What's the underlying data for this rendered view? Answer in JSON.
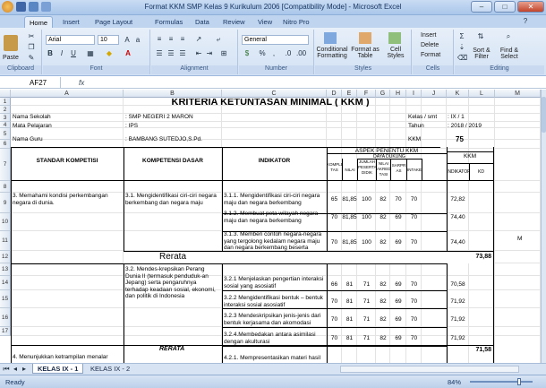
{
  "window": {
    "title": "Format KKM SMP Kelas 9 Kurikulum 2006  [Compatibility Mode]  -  Microsoft Excel"
  },
  "tabs": [
    "Home",
    "Insert",
    "Page Layout",
    "Formulas",
    "Data",
    "Review",
    "View",
    "Nitro Pro"
  ],
  "ribbon": {
    "clipboard": {
      "label": "Clipboard",
      "paste": "Paste"
    },
    "font": {
      "label": "Font",
      "name": "Arial",
      "size": "10"
    },
    "alignment": {
      "label": "Alignment"
    },
    "number": {
      "label": "Number",
      "format": "General",
      "currency": "$",
      "percent": "%",
      "comma": ","
    },
    "styles": {
      "label": "Styles",
      "cond": "Conditional Formatting",
      "fmt_table": "Format as Table",
      "cell_styles": "Cell Styles"
    },
    "cells": {
      "label": "Cells",
      "insert": "Insert",
      "delete": "Delete",
      "format": "Format"
    },
    "editing": {
      "label": "Editing",
      "sort": "Sort & Filter",
      "find": "Find & Select"
    }
  },
  "formula_bar": {
    "name_box": "AF27",
    "fx": "fx",
    "value": ""
  },
  "columns": [
    "A",
    "B",
    "C",
    "D",
    "E",
    "F",
    "G",
    "H",
    "I",
    "J",
    "K",
    "L",
    "M"
  ],
  "rows": [
    "1",
    "2",
    "3",
    "4",
    "5",
    "6",
    "7",
    "8",
    "9",
    "10",
    "11",
    "12",
    "13",
    "14",
    "15",
    "16",
    "17"
  ],
  "sheet": {
    "title": "KRITERIA KETUNTASAN MINIMAL ( KKM )",
    "info": [
      {
        "label": "Nama Sekolah",
        "value": ": SMP NEGERI 2 MARON"
      },
      {
        "label": "Mata Pelajaran",
        "value": ": IPS"
      },
      {
        "label": "Nama Guru",
        "value": ": BAMBANG SUTEDJO,S.Pd."
      }
    ],
    "info_right": [
      {
        "label": "Kelas / smt",
        "value": ":   IX / 1"
      },
      {
        "label": "Tahun Pelajaran",
        "value": ":   2018 / 2019"
      },
      {
        "label": "KKM",
        "value": "75"
      }
    ],
    "headers": {
      "standar": "STANDAR KOMPETISI",
      "kompetensi": "KOMPETENSI DASAR",
      "indikator": "INDIKATOR",
      "aspek": "ASPEK PENENTU KKM",
      "daya_dukung": "DAYA DUKUNG",
      "kompleksitas": "KOMPLEKSI TAS",
      "nilai_uks": "NILAI UKS",
      "jumlah_peserta": "JUMLAH PESERTA DIDIK",
      "nilai_akreditasi": "NILAI AKREDI TASI",
      "sarpras": "SARPR AS",
      "intake": "INTAKE",
      "kkm": "KKM",
      "indikator_k": "INDIKATOR",
      "kd": "KD"
    },
    "standar_1": "3. Memahami kondisi perkembangan negara di dunia.",
    "kd_1": "3.1.   Mengidentifikasi ciri-ciri negara berkembang dan negara maju",
    "kd_2": "3.2.   Mendes-krepsikan Perang Dunia II (termasuk penduduk-an Jepang) serta pengaruhnya terhadap keadaan sosial, ekonomi, dan politik di Indonesia",
    "standar_2": "4. Menunjukkan ketrampilan menalar",
    "rerata_1": "Rerata",
    "rerata_1_value": "73,88",
    "rerata_2": "RERATA",
    "rerata_2_value": "71,58",
    "stray_m": "M",
    "indicators": [
      {
        "text": "3.1.1.   Mengidentifikasi ciri-ciri negara maju dan negara berkembang",
        "vals": [
          "65",
          "81,85",
          "100",
          "82",
          "70",
          "70",
          "72,82"
        ]
      },
      {
        "text": "3.1.2. Membuat peta wilayah negara maju dan negara berkembang",
        "vals": [
          "70",
          "81,85",
          "100",
          "82",
          "69",
          "70",
          "74,40"
        ]
      },
      {
        "text": "3.1.3. Memberi contoh negara-negara yang tergolong kedalam negara maju dan negara berkembang beserta alasannya.",
        "vals": [
          "70",
          "81,85",
          "100",
          "82",
          "69",
          "70",
          "74,40"
        ]
      },
      {
        "text": "3.2.1          Menjelaskan pengertian interaksi sosial yang asosiatif",
        "vals": [
          "66",
          "81",
          "71",
          "82",
          "69",
          "70",
          "70,58"
        ]
      },
      {
        "text": "3.2.2          Mengidentifikasi bentuk – bentuk interaksi sosial asosiatif",
        "vals": [
          "70",
          "81",
          "71",
          "82",
          "69",
          "70",
          "71,92"
        ]
      },
      {
        "text": "3.2.3          Mendeskripsikan jenis-jenis dari bentuk kerjasama dan akomodasi",
        "vals": [
          "70",
          "81",
          "71",
          "82",
          "69",
          "70",
          "71,92"
        ]
      },
      {
        "text": "3.2.4.Membedakan antara asimilasi dengan  akulturasi",
        "vals": [
          "70",
          "81",
          "71",
          "82",
          "69",
          "70",
          "71,92"
        ]
      },
      {
        "text": "4.2.1. Mempresentasikan materi hasil",
        "vals": []
      }
    ]
  },
  "sheet_tabs": [
    "KELAS IX - 1",
    "KELAS IX - 2"
  ],
  "status": {
    "ready": "Ready",
    "zoom": "84%"
  }
}
